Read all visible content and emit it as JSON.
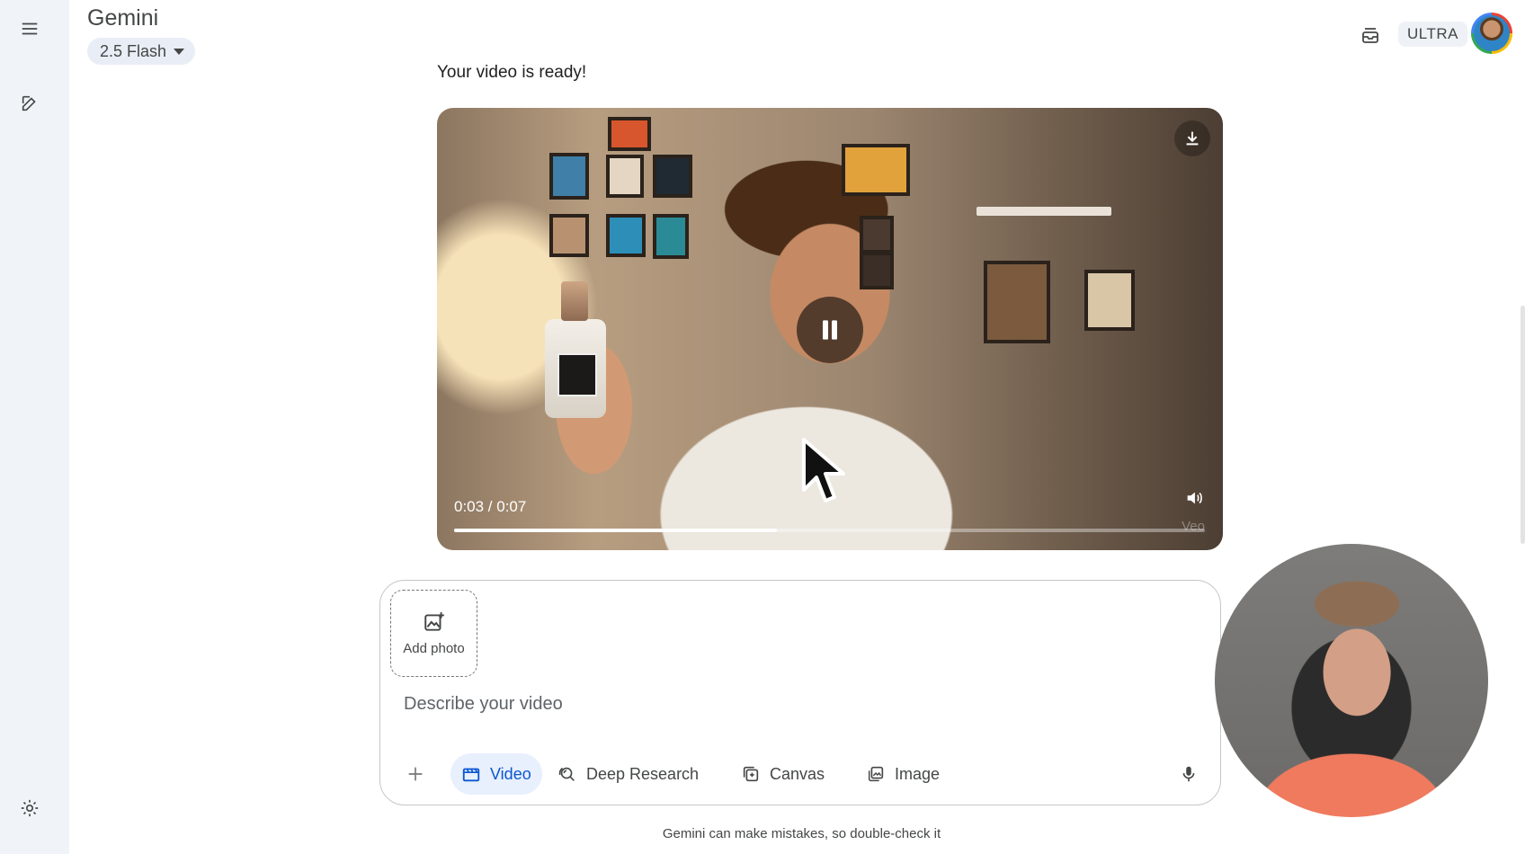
{
  "app": {
    "title": "Gemini",
    "model": "2.5 Flash",
    "plan_badge": "ULTRA"
  },
  "sidebar": {
    "menu_icon": "menu-icon",
    "new_chat_icon": "edit-icon",
    "settings_icon": "settings-icon"
  },
  "header": {
    "inbox_icon": "inbox-icon",
    "avatar": "user-avatar"
  },
  "response": {
    "text": "Your video is ready!",
    "video": {
      "current_time": "0:03",
      "duration": "0:07",
      "time_display": "0:03 / 0:07",
      "progress_fraction": 0.43,
      "watermark": "Veo",
      "state": "playing"
    }
  },
  "composer": {
    "add_photo_label": "Add photo",
    "placeholder": "Describe your video",
    "tools": [
      {
        "label": "Video",
        "icon": "video-icon",
        "active": true
      },
      {
        "label": "Deep Research",
        "icon": "deep-research-icon",
        "active": false
      },
      {
        "label": "Canvas",
        "icon": "canvas-icon",
        "active": false
      },
      {
        "label": "Image",
        "icon": "image-icon",
        "active": false
      }
    ]
  },
  "footer": {
    "disclaimer": "Gemini can make mistakes, so double-check it"
  },
  "colors": {
    "accent": "#0b57d0",
    "rail_bg": "#f0f4f9",
    "active_tool_bg": "#e8f0fe"
  }
}
